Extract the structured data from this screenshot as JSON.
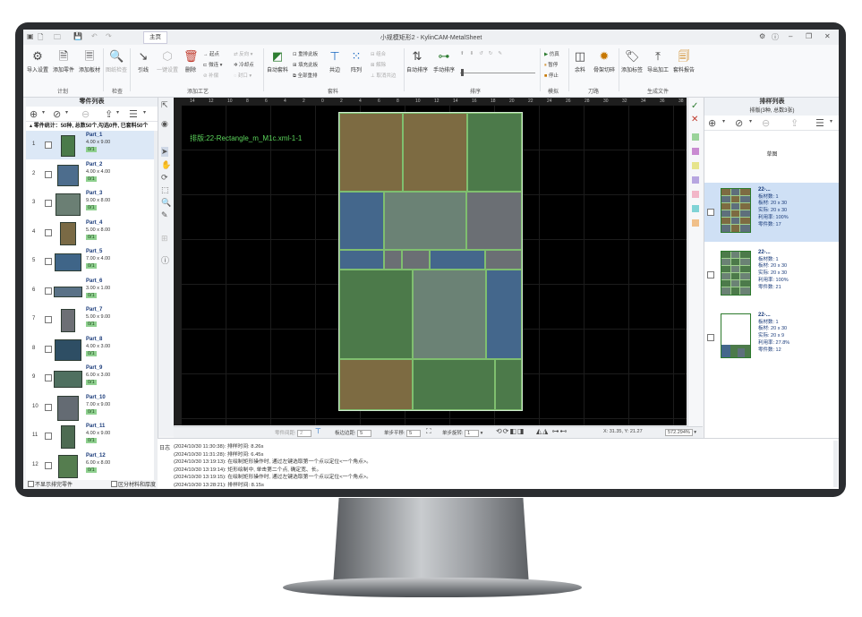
{
  "app": {
    "title": "小规模矩形2 - KylinCAM-MetalSheet",
    "main_tab": "主页"
  },
  "ribbon": {
    "groups": [
      {
        "label": "计划",
        "buttons": [
          "导入设置",
          "添加零件",
          "添加板材"
        ]
      },
      {
        "label": "检查",
        "buttons": [
          "图纸检查"
        ]
      },
      {
        "label": "添加工艺",
        "buttons": [
          "引线",
          "一键设置",
          "删除"
        ],
        "small": [
          "起点",
          "微连",
          "补偿",
          "反向",
          "冷却点",
          "封口"
        ]
      },
      {
        "label": "套料",
        "buttons": [
          "自动套料",
          "共边",
          "阵列"
        ],
        "small": [
          "重排此板",
          "填充此板",
          "全部重排",
          "组合",
          "解除",
          "取消共边"
        ]
      },
      {
        "label": "排序",
        "buttons": [
          "自动排序",
          "手动排序"
        ]
      },
      {
        "label": "模拟",
        "small": [
          "仿真",
          "暂停",
          "停止"
        ]
      },
      {
        "label": "刀路",
        "buttons": [
          "余料",
          "骨架切碎"
        ]
      },
      {
        "label": "生成文件",
        "buttons": [
          "添加标签",
          "导出加工",
          "套料报告"
        ]
      }
    ]
  },
  "left_panel": {
    "title": "零件列表",
    "stats": "零件统计：50种, 总数50个,勾选0件, 已套料50个",
    "parts": [
      {
        "num": "1",
        "name": "Part_1",
        "size": "4.00 x 9.00",
        "qty": "0/1",
        "color": "#4a7a4a"
      },
      {
        "num": "2",
        "name": "Part_2",
        "size": "4.00 x 4.00",
        "qty": "0/1",
        "color": "#4d6d8d"
      },
      {
        "num": "3",
        "name": "Part_3",
        "size": "9.00 x 8.00",
        "qty": "0/1",
        "color": "#6b7f74"
      },
      {
        "num": "4",
        "name": "Part_4",
        "size": "5.00 x 8.00",
        "qty": "0/1",
        "color": "#7a6a45"
      },
      {
        "num": "5",
        "name": "Part_5",
        "size": "7.00 x 4.00",
        "qty": "0/1",
        "color": "#3f6588"
      },
      {
        "num": "6",
        "name": "Part_6",
        "size": "3.00 x 1.00",
        "qty": "0/1",
        "color": "#5a7287"
      },
      {
        "num": "7",
        "name": "Part_7",
        "size": "5.00 x 9.00",
        "qty": "0/1",
        "color": "#6d6f75"
      },
      {
        "num": "8",
        "name": "Part_8",
        "size": "4.00 x 3.00",
        "qty": "0/1",
        "color": "#2e4e64"
      },
      {
        "num": "9",
        "name": "Part_9",
        "size": "6.00 x 3.00",
        "qty": "0/1",
        "color": "#4f7060"
      },
      {
        "num": "10",
        "name": "Part_10",
        "size": "7.00 x 9.00",
        "qty": "0/1",
        "color": "#646b73"
      },
      {
        "num": "11",
        "name": "Part_11",
        "size": "4.00 x 9.00",
        "qty": "0/1",
        "color": "#4d6b52"
      },
      {
        "num": "12",
        "name": "Part_12",
        "size": "6.00 x 8.00",
        "qty": "0/1",
        "color": "#557d4f"
      }
    ],
    "footer_left": "不显示排完零件",
    "footer_right": "区分材料和厚度"
  },
  "canvas": {
    "sheet_label": "排版:22-Rectangle_m_M1c.xml-1-1",
    "ruler_ticks": [
      "14",
      "12",
      "10",
      "8",
      "6",
      "4",
      "2",
      "0",
      "2",
      "4",
      "6",
      "8",
      "10",
      "12",
      "14",
      "16",
      "18",
      "20",
      "22",
      "24",
      "26",
      "28",
      "30",
      "32",
      "34",
      "36",
      "38"
    ],
    "piece_colors": {
      "brown": "#7d6b42",
      "green": "#4c7a4a",
      "blue": "#44678c",
      "slate": "#5e6f7c",
      "grey": "#6b6f74",
      "sage": "#6b8275"
    }
  },
  "canvas_status": {
    "part_gap_label": "零件间距:",
    "part_gap": "2",
    "edge_gap_label": "板边边距:",
    "edge_gap": "5",
    "step_move_label": "单步平移:",
    "step_move": "5",
    "step_rotate_label": "单步旋转:",
    "step_rotate": "1",
    "coords": "X: 31.35, Y: 21.27",
    "zoom": "572.294%"
  },
  "right_panel": {
    "title": "排样列表",
    "subtitle": "排版(3种, 总数3张)",
    "sketch_label": "草图",
    "nests": [
      {
        "name": "22-...",
        "sheet_count": "板材数: 1",
        "sheet_size": "板材: 20 x 30",
        "actual": "实际: 20 x 30",
        "util": "利用率: 100%",
        "parts": "零件数: 17"
      },
      {
        "name": "22-...",
        "sheet_count": "板材数: 1",
        "sheet_size": "板材: 20 x 30",
        "actual": "实际: 20 x 30",
        "util": "利用率: 100%",
        "parts": "零件数: 21"
      },
      {
        "name": "22-...",
        "sheet_count": "板材数: 1",
        "sheet_size": "板材: 20 x 30",
        "actual": "实际: 20 x 9",
        "util": "利用率: 27.8%",
        "parts": "零件数: 12"
      }
    ]
  },
  "log": {
    "label": "日志",
    "lines": [
      "(2024/10/30 11:30:38): 排样时间: 8.26s",
      "(2024/10/30 11:31:28): 排样时间: 6.45s",
      "(2024/10/30 13:19:13): 在绘制矩形操作时, 通过左键选取第一个点以定位<一个角点>。",
      "(2024/10/30 13:19:14): 矩形绘制中, 单击第二个点, 确定宽、长。",
      "(2024/10/30 13:19:15): 在绘制矩形操作时, 通过左键选取第一个点以定位<一个角点>。",
      "(2024/10/30 13:28:21): 排样时间: 8.15s"
    ]
  }
}
